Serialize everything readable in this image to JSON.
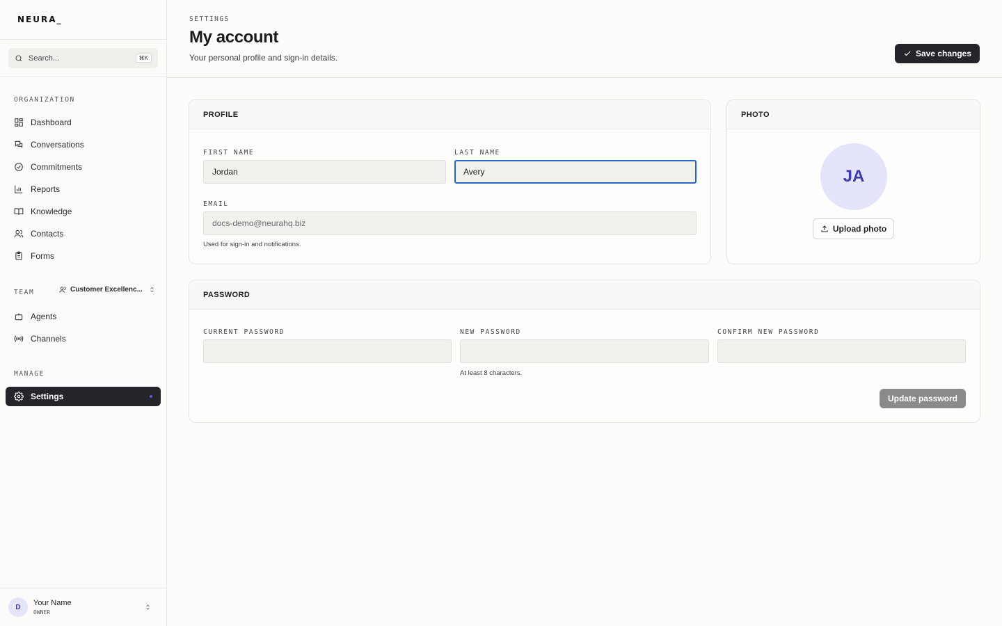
{
  "brand": {
    "logo": "NEURA_"
  },
  "search": {
    "placeholder": "Search...",
    "shortcut": "⌘K"
  },
  "sidebar": {
    "organization_label": "ORGANIZATION",
    "organization_items": [
      {
        "label": "Dashboard",
        "icon": "grid-icon"
      },
      {
        "label": "Conversations",
        "icon": "chat-icon"
      },
      {
        "label": "Commitments",
        "icon": "check-circle-icon"
      },
      {
        "label": "Reports",
        "icon": "bar-chart-icon"
      },
      {
        "label": "Knowledge",
        "icon": "book-icon"
      },
      {
        "label": "Contacts",
        "icon": "users-icon"
      },
      {
        "label": "Forms",
        "icon": "clipboard-icon"
      }
    ],
    "team_label": "TEAM",
    "team_name": "Customer Excellenc...",
    "team_items": [
      {
        "label": "Agents",
        "icon": "bot-icon"
      },
      {
        "label": "Channels",
        "icon": "radio-icon"
      }
    ],
    "manage_label": "MANAGE",
    "manage_items": [
      {
        "label": "Settings",
        "icon": "gear-icon",
        "active": true
      }
    ]
  },
  "user": {
    "initial": "D",
    "name": "Your Name",
    "role": "OWNER"
  },
  "header": {
    "eyebrow": "SETTINGS",
    "title": "My account",
    "subtitle": "Your personal profile and sign-in details.",
    "save_label": "Save changes"
  },
  "profile": {
    "title": "PROFILE",
    "first_name_label": "FIRST NAME",
    "first_name_value": "Jordan",
    "last_name_label": "LAST NAME",
    "last_name_value": "Avery",
    "email_label": "EMAIL",
    "email_value": "docs-demo@neurahq.biz",
    "email_hint": "Used for sign-in and notifications."
  },
  "photo": {
    "title": "PHOTO",
    "initials": "JA",
    "upload_label": "Upload photo"
  },
  "password": {
    "title": "PASSWORD",
    "current_label": "CURRENT PASSWORD",
    "new_label": "NEW PASSWORD",
    "new_hint": "At least 8 characters.",
    "confirm_label": "CONFIRM NEW PASSWORD",
    "update_label": "Update password"
  },
  "colors": {
    "accent": "#24252a",
    "focus": "#2766c7",
    "avatar_bg": "#e4e4fb",
    "avatar_text": "#3b3bb0"
  }
}
